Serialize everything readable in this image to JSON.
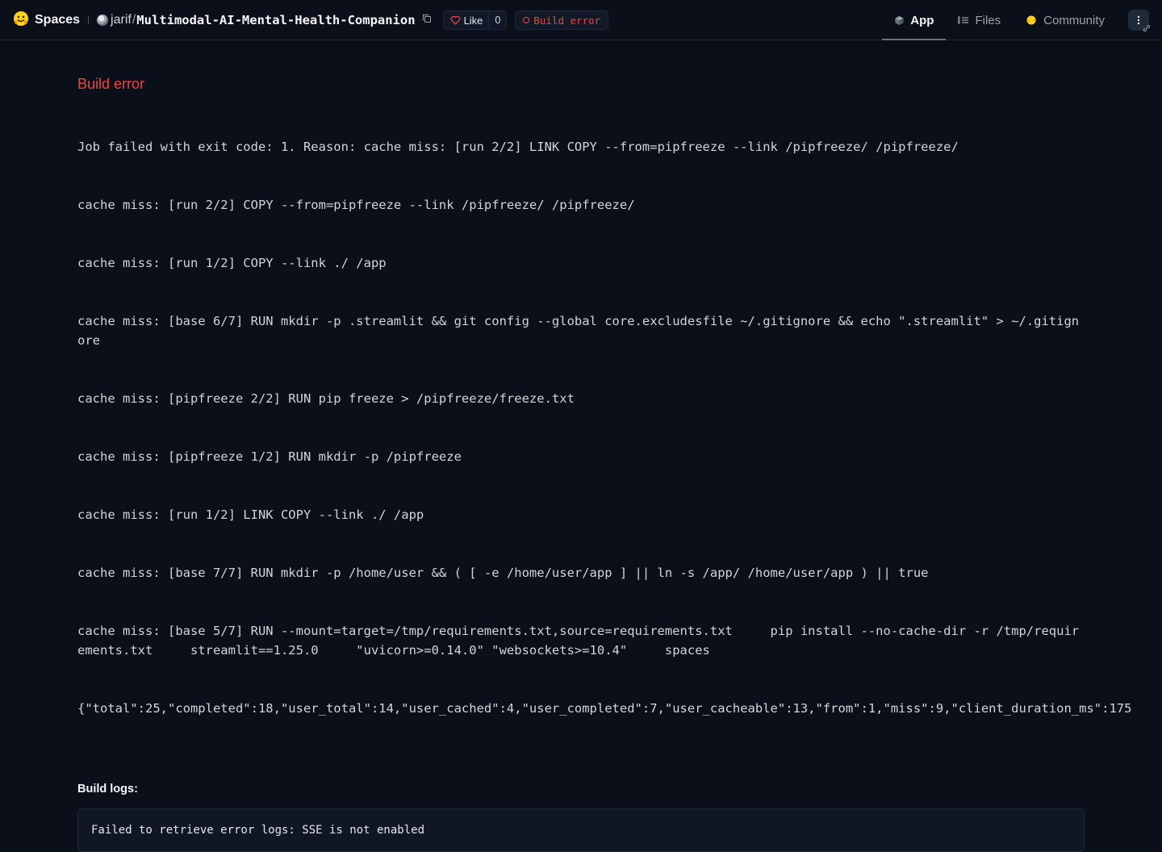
{
  "header": {
    "brand": "Spaces",
    "owner": "jarif",
    "separator": "/",
    "repo": "Multimodal-AI-Mental-Health-Companion",
    "like_label": "Like",
    "like_count": "0",
    "status": "Build error",
    "status_color": "#ef4444",
    "tabs": [
      {
        "label": "App",
        "icon": "cube-icon",
        "active": true
      },
      {
        "label": "Files",
        "icon": "files-tree-icon",
        "active": false
      },
      {
        "label": "Community",
        "icon": "community-icon",
        "active": false
      }
    ]
  },
  "main": {
    "error_title": "Build error",
    "error_lines": [
      "Job failed with exit code: 1. Reason: cache miss: [run 2/2] LINK COPY --from=pipfreeze --link /pipfreeze/ /pipfreeze/",
      "cache miss: [run 2/2] COPY --from=pipfreeze --link /pipfreeze/ /pipfreeze/",
      "cache miss: [run 1/2] COPY --link ./ /app",
      "cache miss: [base 6/7] RUN mkdir -p .streamlit && git config --global core.excludesfile ~/.gitignore && echo \".streamlit\" > ~/.gitignore",
      "cache miss: [pipfreeze 2/2] RUN pip freeze > /pipfreeze/freeze.txt",
      "cache miss: [pipfreeze 1/2] RUN mkdir -p /pipfreeze",
      "cache miss: [run 1/2] LINK COPY --link ./ /app",
      "cache miss: [base 7/7] RUN mkdir -p /home/user && ( [ -e /home/user/app ] || ln -s /app/ /home/user/app ) || true",
      "cache miss: [base 5/7] RUN --mount=target=/tmp/requirements.txt,source=requirements.txt     pip install --no-cache-dir -r /tmp/requirements.txt     streamlit==1.25.0     \"uvicorn>=0.14.0\" \"websockets>=10.4\"     spaces"
    ],
    "error_json_line": "{\"total\":25,\"completed\":18,\"user_total\":14,\"user_cached\":4,\"user_completed\":7,\"user_cacheable\":13,\"from\":1,\"miss\":9,\"client_duration_ms\":175",
    "logs_label": "Build logs:",
    "logs_message": "Failed to retrieve error logs: SSE is not enabled"
  },
  "colors": {
    "background": "#0b0f19",
    "error": "#ef4444",
    "text": "#d1d5db"
  }
}
